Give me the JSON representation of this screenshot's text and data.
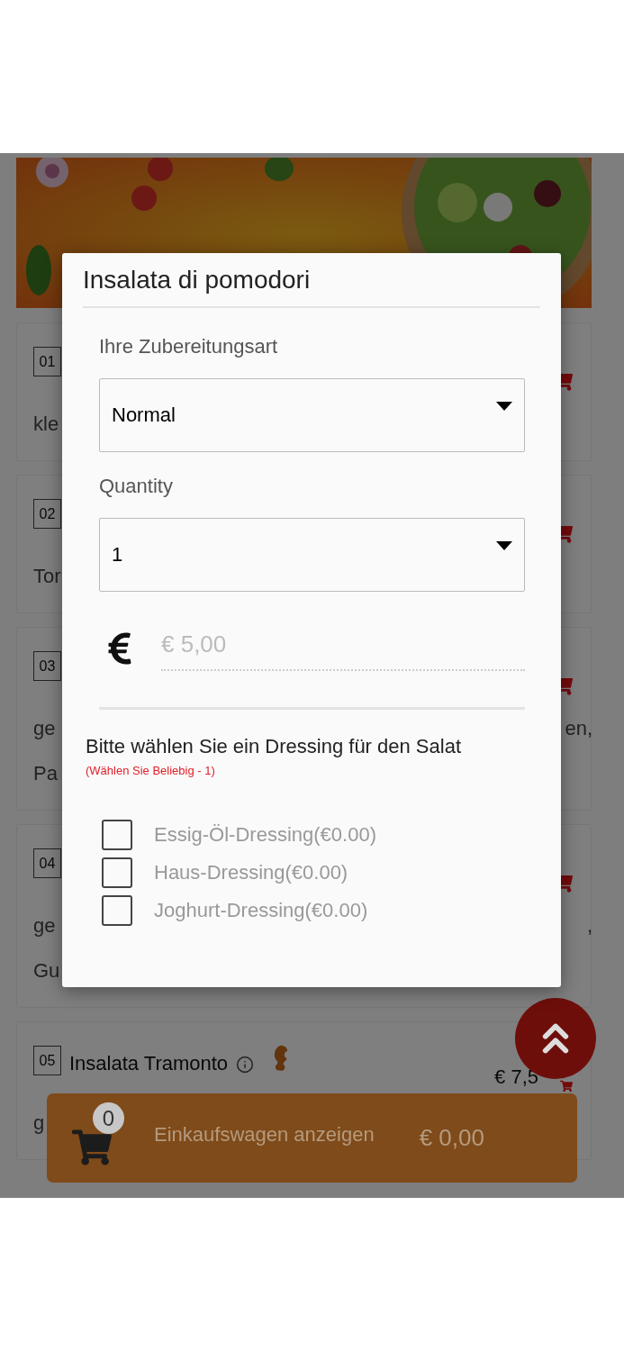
{
  "menu_items": [
    {
      "number": "01",
      "lines": [
        {
          "left": "kle"
        }
      ]
    },
    {
      "number": "02",
      "lines": [
        {
          "left": "Tor"
        }
      ]
    },
    {
      "number": "03",
      "lines": [
        {
          "left": "ge",
          "right": "en,"
        },
        {
          "left": "Pa"
        }
      ]
    },
    {
      "number": "04",
      "lines": [
        {
          "left": "ge",
          "right": ","
        },
        {
          "left": "Gu"
        }
      ]
    },
    {
      "number": "05",
      "name": "Insalata Tramonto",
      "price": "€ 7,5",
      "lines": [
        {
          "left": "g"
        }
      ]
    }
  ],
  "modal": {
    "title": "Insalata di pomodori",
    "fields": [
      {
        "label": "Ihre Zubereitungsart",
        "value": "Normal"
      },
      {
        "label": "Quantity",
        "value": "1"
      }
    ],
    "price": "€ 5,00",
    "dressing": {
      "title": "Bitte wählen Sie ein Dressing für den Salat",
      "note": "(Wählen Sie Beliebig - 1)",
      "options": [
        {
          "label": "Essig-Öl-Dressing(€0.00)",
          "checked": false
        },
        {
          "label": "Haus-Dressing(€0.00)",
          "checked": false
        },
        {
          "label": "Joghurt-Dressing(€0.00)",
          "checked": false
        }
      ]
    }
  },
  "cart": {
    "count": "0",
    "label": "Einkaufswagen anzeigen",
    "total": "€ 0,00"
  }
}
